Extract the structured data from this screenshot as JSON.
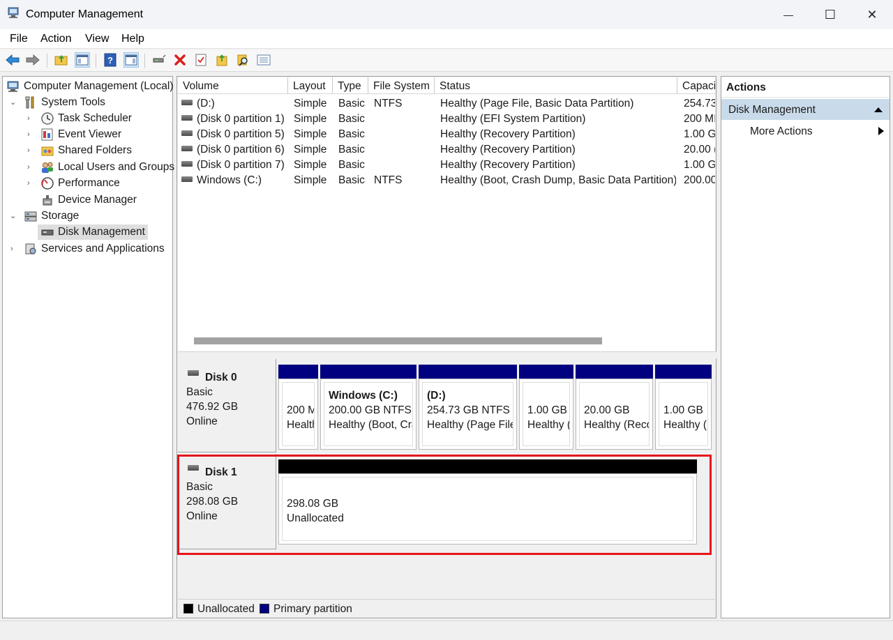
{
  "window": {
    "title": "Computer Management",
    "minimize_glyph": "—",
    "maximize_glyph": "☐",
    "close_glyph": "✕"
  },
  "menu": {
    "items": [
      "File",
      "Action",
      "View",
      "Help"
    ]
  },
  "toolbar": {
    "icons": [
      "back-arrow-icon",
      "forward-arrow-icon",
      "up-folder-icon",
      "show-hide-console-tree-icon",
      "help-icon",
      "show-hide-action-pane-icon",
      "connect-icon",
      "delete-icon",
      "properties-icon",
      "open-icon",
      "search-icon",
      "export-list-icon"
    ]
  },
  "tree": {
    "root": "Computer Management (Local)",
    "system_tools": "System Tools",
    "task_scheduler": "Task Scheduler",
    "event_viewer": "Event Viewer",
    "shared_folders": "Shared Folders",
    "local_users": "Local Users and Groups",
    "performance": "Performance",
    "device_manager": "Device Manager",
    "storage": "Storage",
    "disk_management": "Disk Management",
    "services_apps": "Services and Applications"
  },
  "volume_list": {
    "columns": [
      "Volume",
      "Layout",
      "Type",
      "File System",
      "Status",
      "Capaci"
    ],
    "rows": [
      {
        "volume": "(D:)",
        "layout": "Simple",
        "type": "Basic",
        "fs": "NTFS",
        "status": "Healthy (Page File, Basic Data Partition)",
        "capacity": "254.73"
      },
      {
        "volume": "(Disk 0 partition 1)",
        "layout": "Simple",
        "type": "Basic",
        "fs": "",
        "status": "Healthy (EFI System Partition)",
        "capacity": "200 MI"
      },
      {
        "volume": "(Disk 0 partition 5)",
        "layout": "Simple",
        "type": "Basic",
        "fs": "",
        "status": "Healthy (Recovery Partition)",
        "capacity": "1.00 GI"
      },
      {
        "volume": "(Disk 0 partition 6)",
        "layout": "Simple",
        "type": "Basic",
        "fs": "",
        "status": "Healthy (Recovery Partition)",
        "capacity": "20.00 ("
      },
      {
        "volume": "(Disk 0 partition 7)",
        "layout": "Simple",
        "type": "Basic",
        "fs": "",
        "status": "Healthy (Recovery Partition)",
        "capacity": "1.00 GI"
      },
      {
        "volume": "Windows (C:)",
        "layout": "Simple",
        "type": "Basic",
        "fs": "NTFS",
        "status": "Healthy (Boot, Crash Dump, Basic Data Partition)",
        "capacity": "200.00"
      }
    ]
  },
  "disks": {
    "disk0": {
      "name": "Disk 0",
      "type": "Basic",
      "size": "476.92 GB",
      "state": "Online",
      "partitions": [
        {
          "title": "",
          "line1": "200 M",
          "line2": "Health"
        },
        {
          "title": "Windows  (C:)",
          "line1": "200.00 GB NTFS",
          "line2": "Healthy (Boot, Cra"
        },
        {
          "title": "(D:)",
          "line1": "254.73 GB NTFS",
          "line2": "Healthy (Page File"
        },
        {
          "title": "",
          "line1": "1.00 GB",
          "line2": "Healthy ("
        },
        {
          "title": "",
          "line1": "20.00 GB",
          "line2": "Healthy (Reco"
        },
        {
          "title": "",
          "line1": "1.00 GB",
          "line2": "Healthy ("
        }
      ]
    },
    "disk1": {
      "name": "Disk 1",
      "type": "Basic",
      "size": "298.08 GB",
      "state": "Online",
      "partition": {
        "line1": "298.08 GB",
        "line2": "Unallocated"
      }
    }
  },
  "legend": {
    "unallocated": "Unallocated",
    "primary": "Primary partition",
    "unallocated_color": "#000000",
    "primary_color": "#000080"
  },
  "actions": {
    "header": "Actions",
    "section": "Disk Management",
    "more": "More Actions"
  },
  "colors": {
    "highlight_border": "#e8141c",
    "partition_header": "#000080",
    "selection": "#c9dbea"
  }
}
